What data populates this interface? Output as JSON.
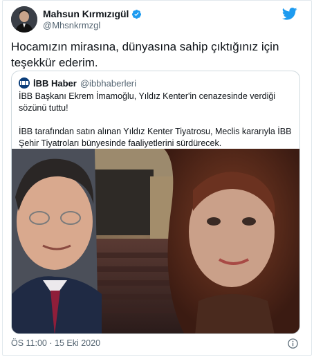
{
  "author": {
    "name": "Mahsun Kırmızıgül",
    "handle": "@Mhsnkrmzgl",
    "verified": true
  },
  "tweet": {
    "text": "Hocamızın mirasına, dünyasına sahip çıktığınız için teşekkür ederim."
  },
  "quote": {
    "name": "İBB Haber",
    "handle": "@ibbhaberleri",
    "paragraph1": "İBB Başkanı Ekrem İmamoğlu, Yıldız Kenter'in cenazesinde verdiği sözünü tuttu!",
    "paragraph2": "İBB tarafından satın alınan Yıldız Kenter Tiyatrosu, Meclis kararıyla İBB Şehir Tiyatroları bünyesinde faaliyetlerini sürdürecek."
  },
  "footer": {
    "timestamp": "ÖS 11:00 · 15 Eki 2020"
  },
  "icons": {
    "verified": "verified-badge-icon",
    "brand": "twitter-bird-icon",
    "info": "info-icon"
  },
  "colors": {
    "brand": "#1d9bf0",
    "text": "#0f1419",
    "secondary": "#536471",
    "border": "#cfd9de"
  }
}
